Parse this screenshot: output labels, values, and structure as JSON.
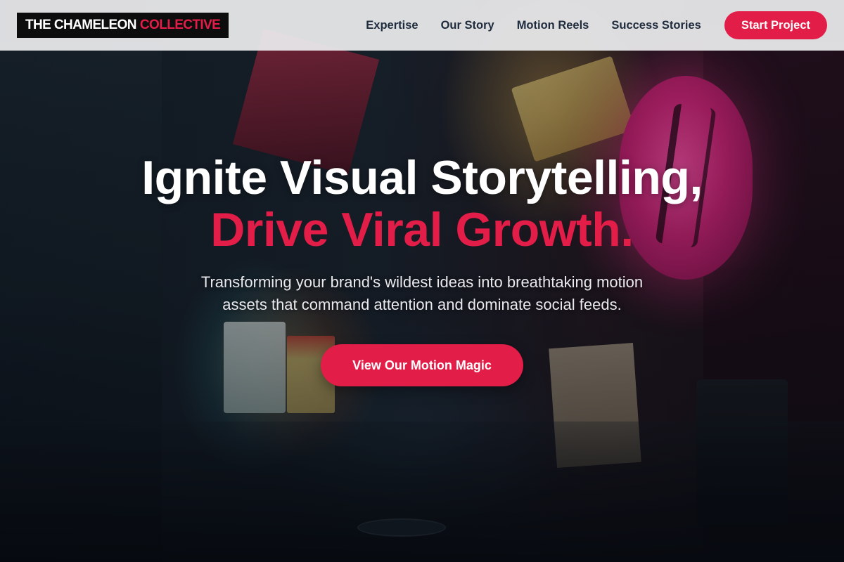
{
  "brand": {
    "name_primary": "THE CHAMELEON",
    "name_accent": "COLLECTIVE",
    "accent_color": "#e11d48"
  },
  "nav": {
    "links": [
      {
        "label": "Expertise"
      },
      {
        "label": "Our Story"
      },
      {
        "label": "Motion Reels"
      },
      {
        "label": "Success Stories"
      }
    ],
    "cta_label": "Start Project"
  },
  "hero": {
    "headline_line1": "Ignite Visual Storytelling,",
    "headline_line2": "Drive Viral Growth.",
    "subtext": "Transforming your brand's wildest ideas into breathtaking motion assets that command attention and dominate social feeds.",
    "cta_label": "View Our Motion Magic"
  }
}
